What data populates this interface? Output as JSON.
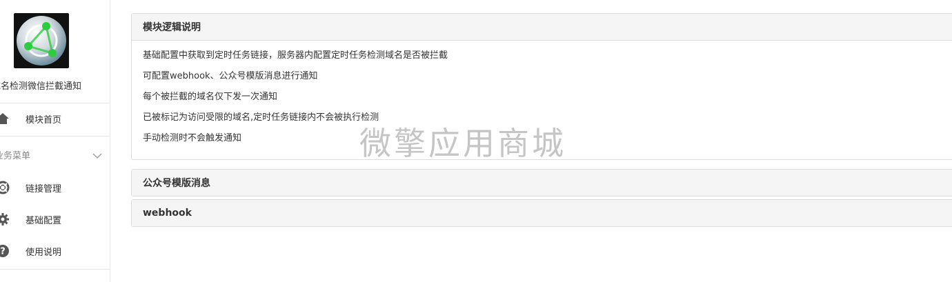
{
  "sidebar": {
    "app_name": "域名检测微信拦截通知",
    "home": {
      "label": "模块首页",
      "icon": "home-icon"
    },
    "group": {
      "label": "业务菜单",
      "icon": "chevron-down-icon"
    },
    "items": [
      {
        "label": "链接管理",
        "icon": "lifebuoy-icon"
      },
      {
        "label": "基础配置",
        "icon": "gear-icon"
      },
      {
        "label": "使用说明",
        "icon": "question-circle-icon"
      }
    ]
  },
  "panels": [
    {
      "title": "模块逻辑说明",
      "lines": [
        "基础配置中获取到定时任务链接，服务器内配置定时任务检测域名是否被拦截",
        "可配置webhook、公众号模版消息进行通知",
        "每个被拦截的域名仅下发一次通知",
        "已被标记为访问受限的域名,定时任务链接内不会被执行检测",
        "手动检测时不会触发通知"
      ]
    },
    {
      "title": "公众号模版消息"
    },
    {
      "title": "webhook"
    }
  ],
  "watermark": "微擎应用商城",
  "colors": {
    "border": "#dcdcdc",
    "heading_bg": "#f5f5f5",
    "logo_green": "#2ecc40"
  }
}
